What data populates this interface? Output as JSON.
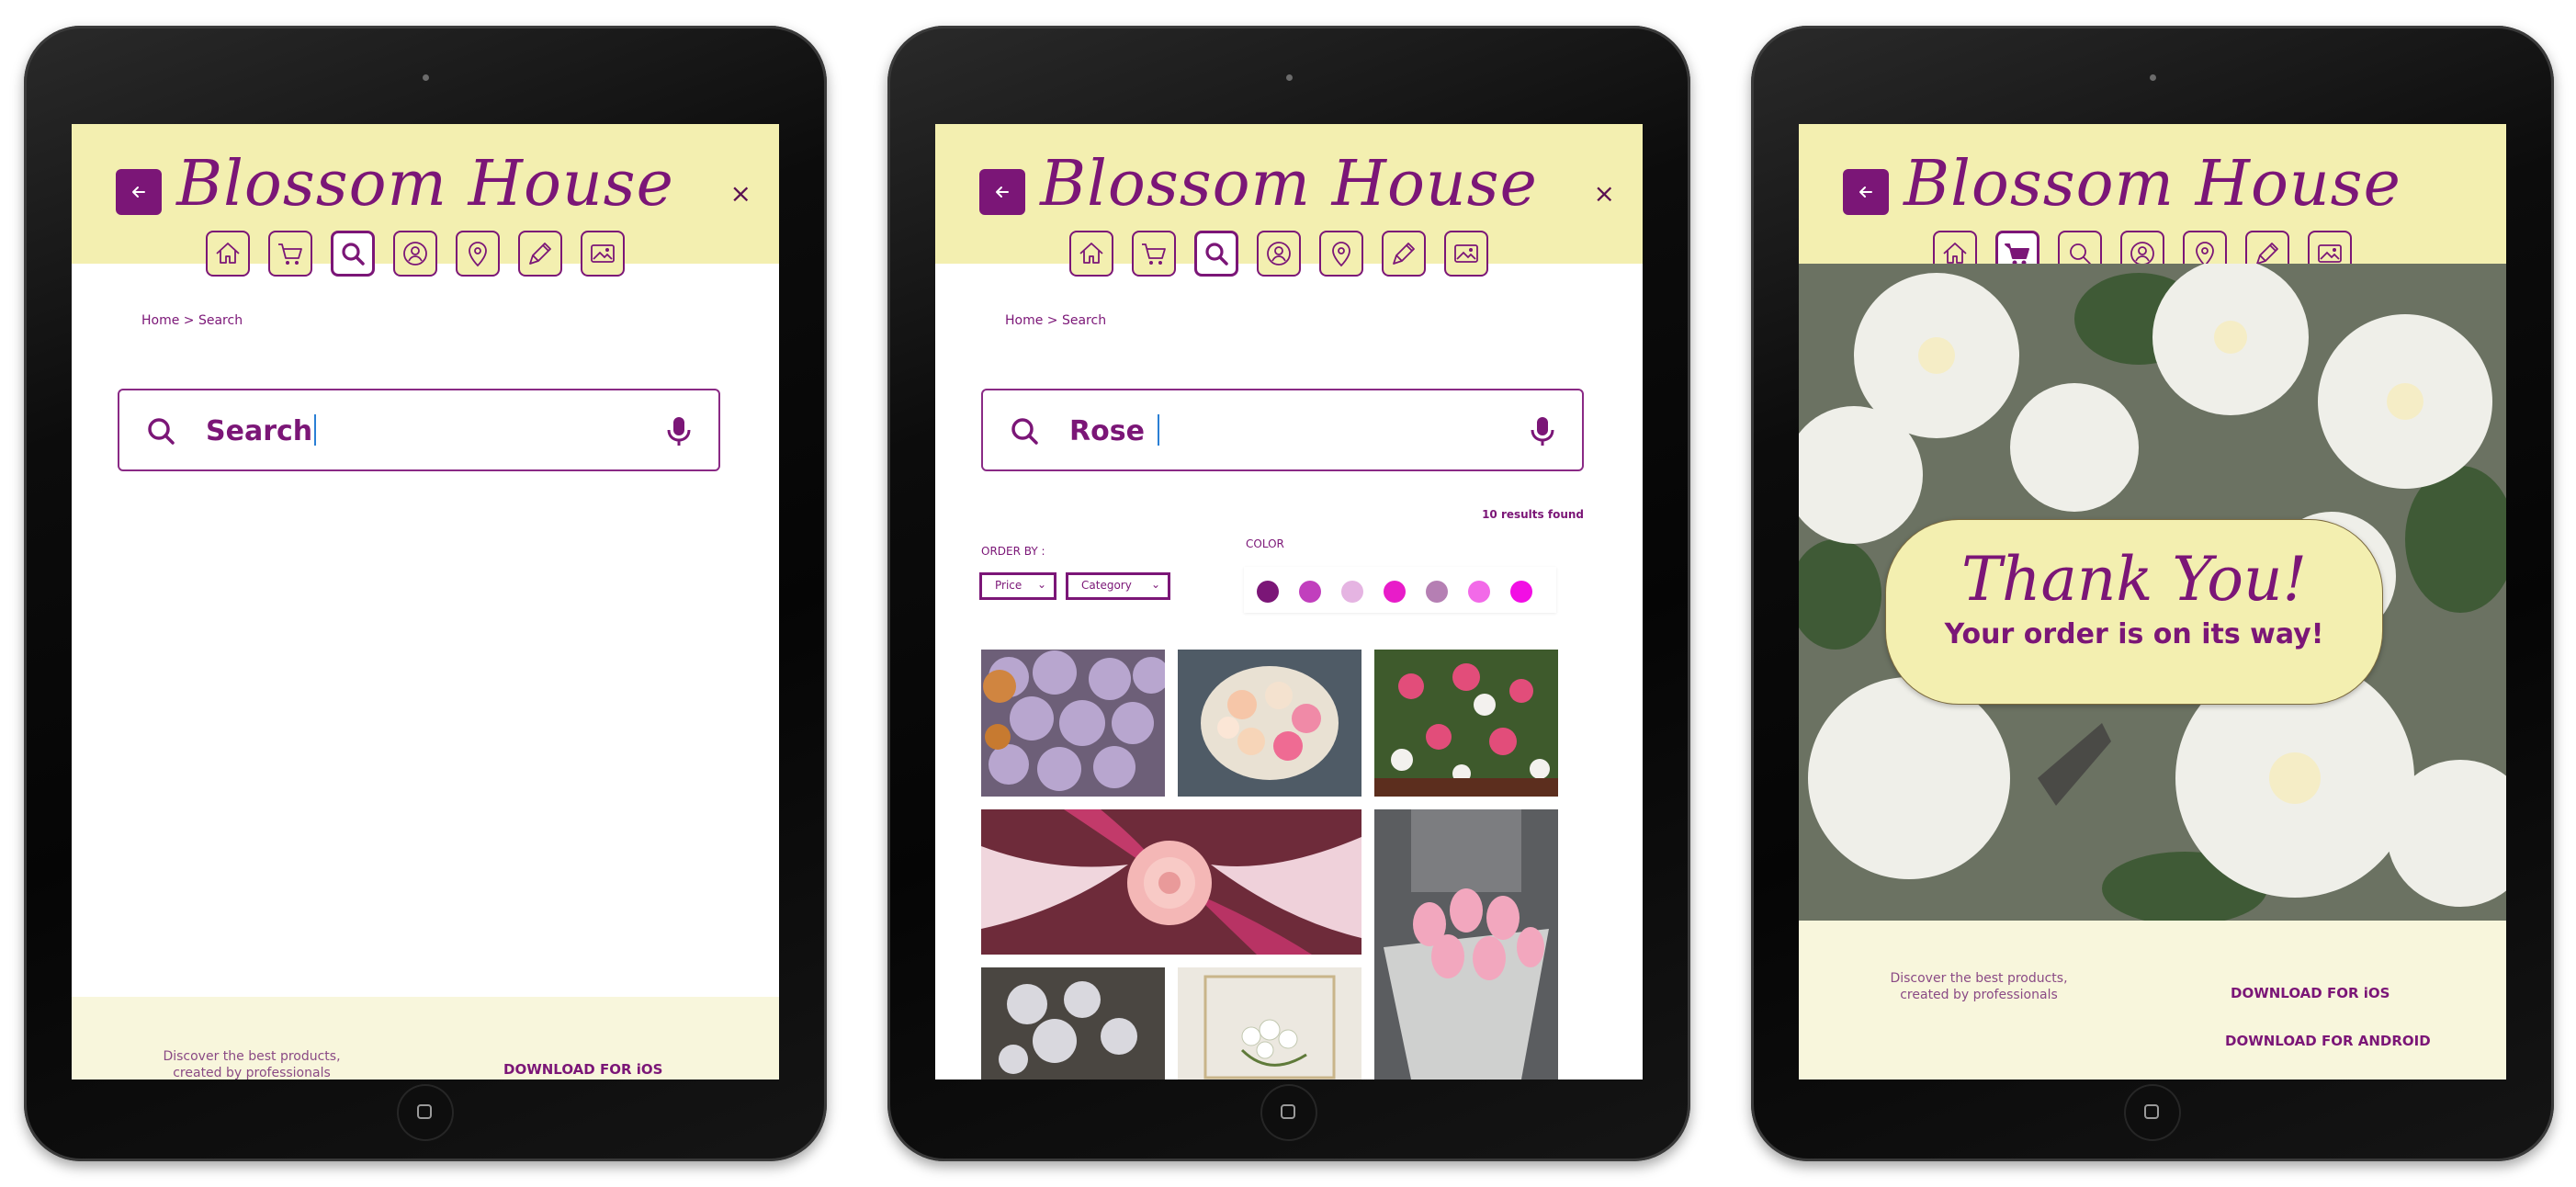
{
  "brand": {
    "name": "Blossom House",
    "primary": "#7b1677",
    "header_bg": "#f3efb0",
    "footer_bg": "#f8f6dc"
  },
  "nav_icons": [
    "home-icon",
    "cart-icon",
    "search-icon",
    "profile-icon",
    "location-icon",
    "pen-icon",
    "gallery-icon"
  ],
  "screens": {
    "search_empty": {
      "active_nav": "search",
      "breadcrumb": "Home > Search",
      "search_value": "Search",
      "footer": {
        "tagline_line1": "Discover the best products,",
        "tagline_line2": "created by professionals",
        "ios_link": "DOWNLOAD FOR iOS"
      }
    },
    "search_results": {
      "active_nav": "search",
      "breadcrumb": "Home > Search",
      "search_value": "Rose",
      "results_count": "10 results found",
      "order_by_label": "ORDER BY :",
      "order_options": [
        "Price",
        "Category"
      ],
      "color_label": "COLOR",
      "color_swatches": [
        "#7b1677",
        "#c13fbd",
        "#e5b4e2",
        "#e81cc9",
        "#b57fb3",
        "#f26ae8",
        "#f20ee4"
      ],
      "photos": [
        "lavender-roses",
        "pastel-bouquet",
        "pink-rose-bouquet",
        "lily-and-rose",
        "pink-tulips",
        "white-blossoms",
        "white-flowers"
      ]
    },
    "order_confirmed": {
      "active_nav": "cart",
      "title": "Thank You!",
      "subtitle": "Your order is on its way!",
      "footer": {
        "tagline_line1": "Discover the best products,",
        "tagline_line2": "created by professionals",
        "ios_link": "DOWNLOAD FOR iOS",
        "android_link": "DOWNLOAD FOR ANDROID"
      }
    }
  }
}
